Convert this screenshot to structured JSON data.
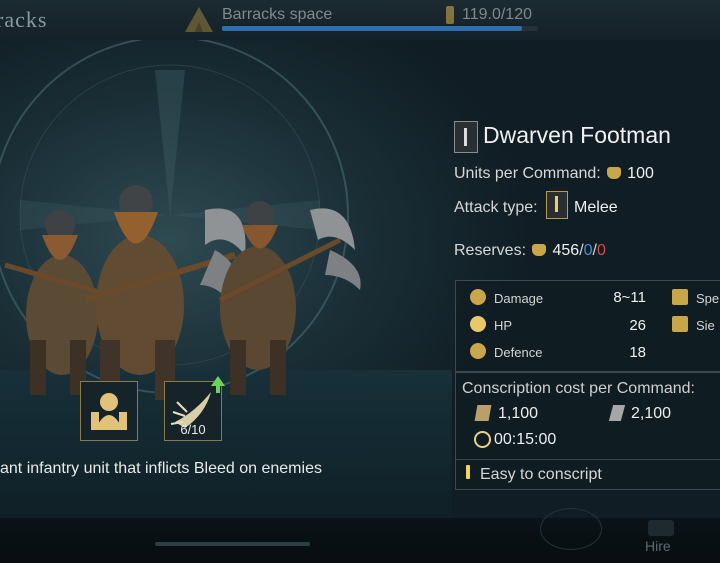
{
  "header": {
    "title": "racks",
    "barracks_label": "Barracks space",
    "barracks_fill": 0.95,
    "capacity": "119.0/120"
  },
  "unit": {
    "name": "Dwarven Footman",
    "tier": "I",
    "units_per_command_label": "Units per Command:",
    "units_per_command": "100",
    "attack_type_label": "Attack type:",
    "attack_type": "Melee",
    "reserves_label": "Reserves:",
    "reserves": "456",
    "reserves_sep1": "/",
    "reserves_b": "0",
    "reserves_sep2": "/",
    "reserves_c": "0"
  },
  "stats": {
    "damage_label": "Damage",
    "damage": "8~11",
    "hp_label": "HP",
    "hp": "26",
    "defence_label": "Defence",
    "defence": "18",
    "speed_label": "Spe",
    "siege_label": "Sie"
  },
  "conscription": {
    "title": "Conscription cost per Command:",
    "wood": "1,100",
    "stone": "2,100",
    "time": "00:15:00",
    "note": "Easy to conscript"
  },
  "abilities": [
    {
      "icon": "dwarf-portrait-icon"
    },
    {
      "icon": "bleed-slash-icon",
      "count": "6/10"
    }
  ],
  "description": "ant infantry unit that inflicts Bleed on enemies",
  "footer": {
    "hire_label": "Hire"
  },
  "colors": {
    "gold": "#c9a64a",
    "blue": "#4a8bd6",
    "red": "#d64a4a",
    "bar_blue": "#2f6fb0"
  }
}
